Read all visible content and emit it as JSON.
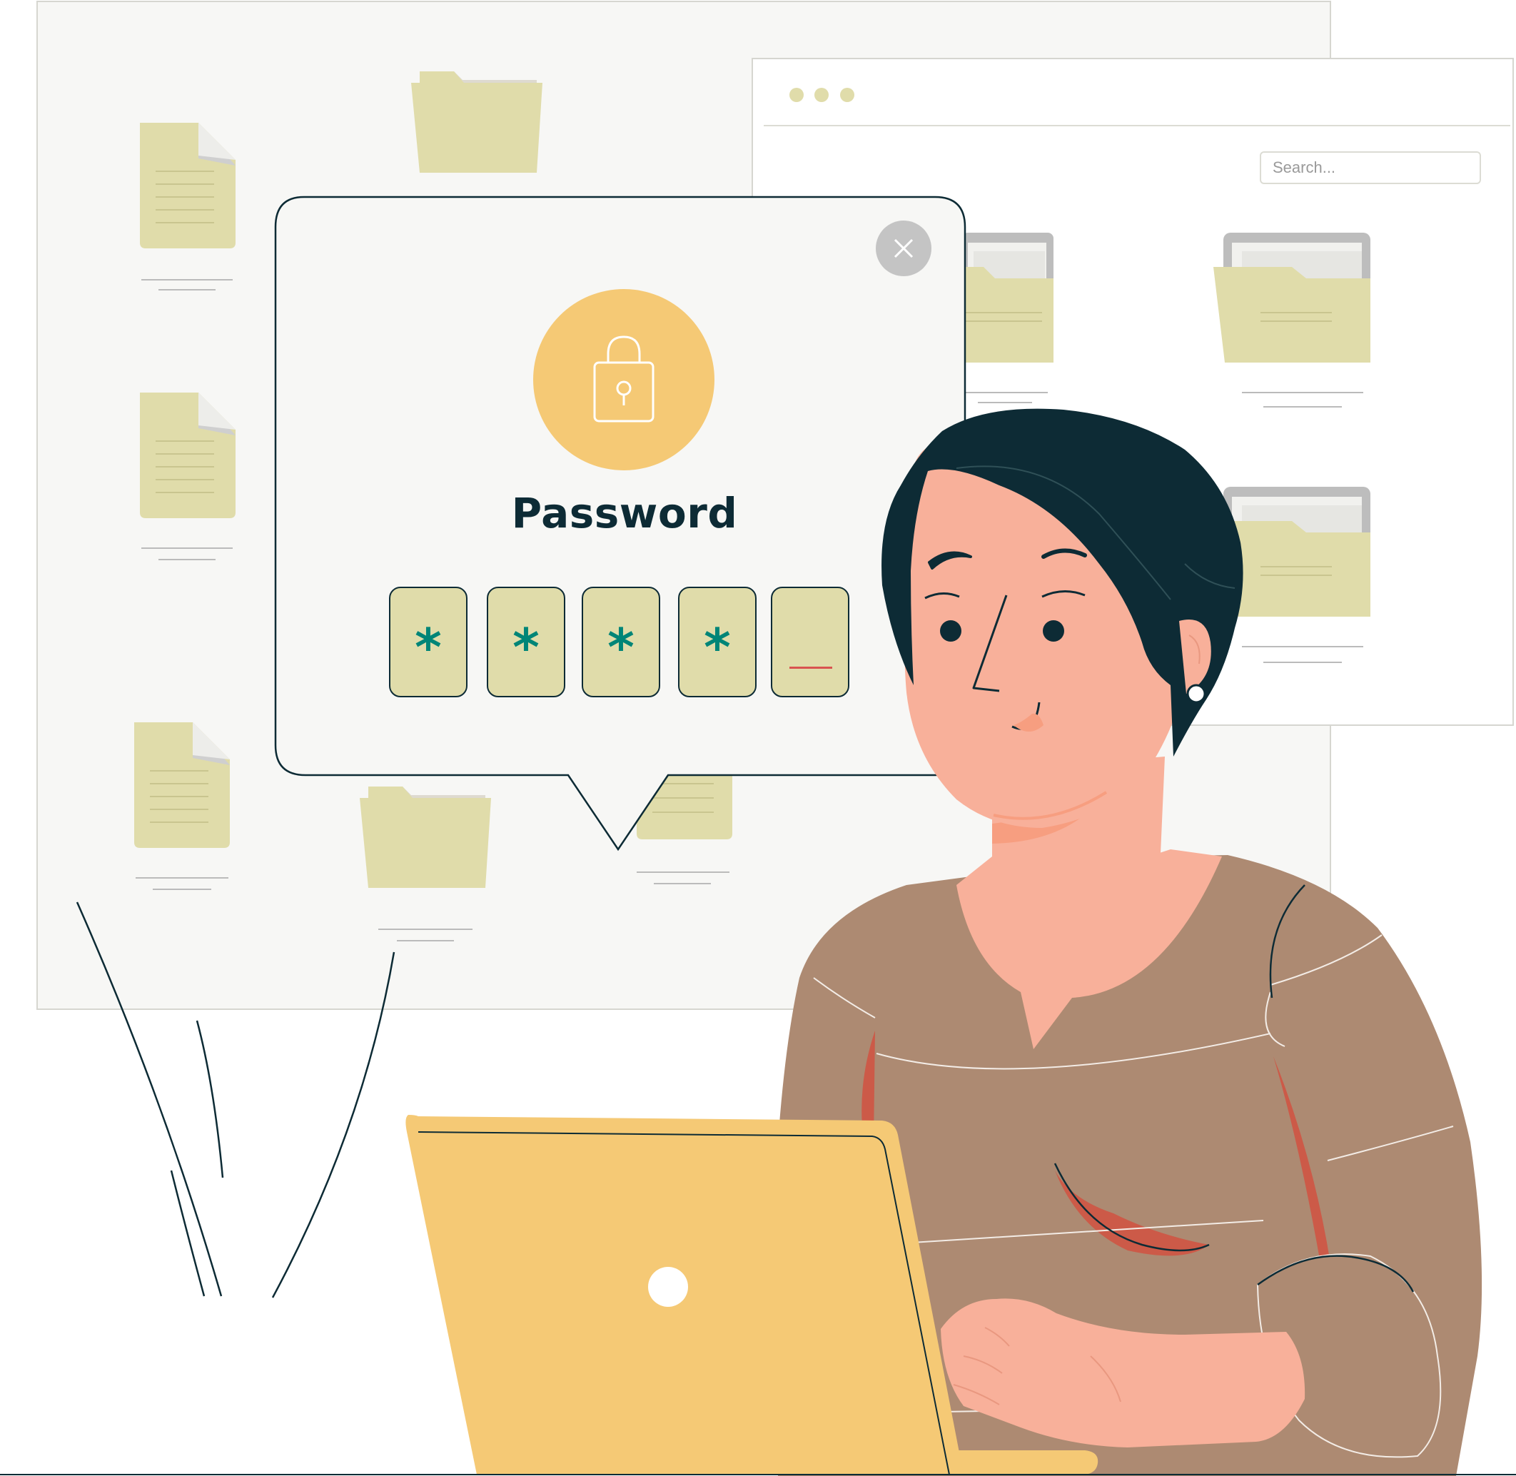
{
  "browser_window": {
    "dots": [
      "dot",
      "dot",
      "dot"
    ],
    "search_placeholder": "Search..."
  },
  "password_dialog": {
    "title": "Password",
    "icon": "lock-icon",
    "close_icon": "close-icon",
    "pin": [
      "*",
      "*",
      "*",
      "*",
      ""
    ]
  },
  "colors": {
    "accent": "#f5c975",
    "folder": "#e0dcaa",
    "pin_char": "#008577",
    "dark": "#0d2b35",
    "sweater": "#ad8a72",
    "skin": "#f8b09a"
  }
}
